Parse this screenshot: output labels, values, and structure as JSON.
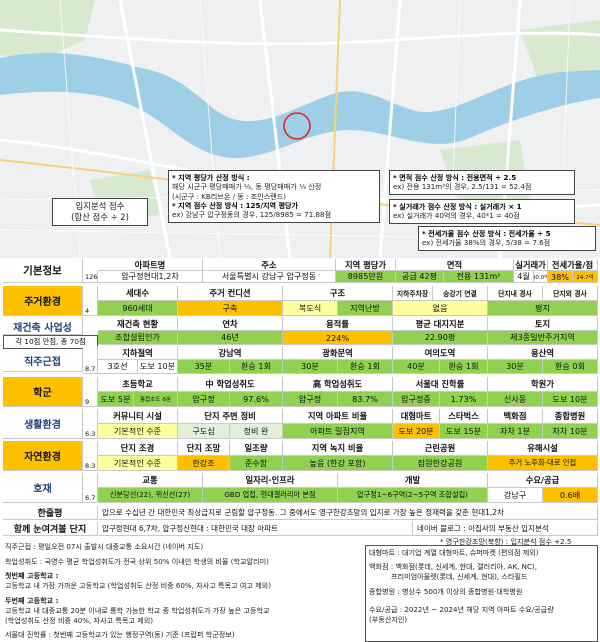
{
  "map": {
    "overlay_colors": {
      "road": "#ffffff",
      "river": "#8fc7e0",
      "park": "#cfe6c4",
      "land": "#eef0f2",
      "highlight": "#e0252b"
    },
    "callouts": {
      "site_score": {
        "title": "입지분석 점수",
        "body": "(합산 점수 ÷ 2)"
      },
      "price": {
        "l1": "* 지역 평당가 산정 방식 :",
        "l2": "해당 시군구 평당매매가 ⅔, 동 평당매매가 ⅓ 산정",
        "l3": "(시군구 : KB리브온 / 동 : 조인스랜드)",
        "l4": "* 지역 점수 산정 방식 : 125/지역 평당가",
        "l5": "ex) 강남구 압구정동의 경우, 125/8985 = 71.88점"
      },
      "area": {
        "l1": "* 면적 점수 산정 방식 : 전용면적 ÷ 2.5",
        "l2": "ex) 전용 131m²의 경우, 2.5/131 = 52.4점"
      },
      "trade": {
        "l1": "* 실거래가 점수 산정 방식 : 실거래가 × 1",
        "l2": "ex) 실거래가 40억의 경우, 40*1 = 40점"
      },
      "jeonse": {
        "l1": "* 전세가율 점수 산정 방식 : 전세가율 ÷ 5",
        "l2": "ex) 전세가율 38%의 경우, 5/38 = 7.6점"
      }
    }
  },
  "table": {
    "basic": {
      "label": "기본정보",
      "index": "126",
      "headers": {
        "apt": "아파트명",
        "addr": "주소",
        "price": "지역 평당가",
        "area": "면적",
        "trade": "실거래가",
        "jeonse": "전세가율/점"
      },
      "apt": "압구정현대1,2차",
      "addr": "서울특별시 강남구 압구정동",
      "price": "8985만원",
      "supply": "공급 42평",
      "exclusive": "전용 131m²",
      "trade": "4월",
      "trade_score": "40.0억",
      "jeonse": "38%",
      "jeonse_score": "24.7억"
    },
    "living": {
      "label": "주거환경",
      "index": "4",
      "headers": [
        "세대수",
        "주거 컨디션",
        "구조",
        "지하주차장",
        "승강기 연결",
        "단지내 경사",
        "단지외 경사"
      ],
      "values": [
        "960세대",
        "구축",
        "복도식",
        "지역난방",
        "없음",
        "",
        "평지"
      ]
    },
    "rebuild": {
      "label": "재건축 사업성",
      "note": "각 10점 만점, 총 70점",
      "headers": [
        "재건축 현황",
        "연차",
        "용적률",
        "평균 대지지분",
        "토지"
      ],
      "values": [
        "조합설립인가",
        "46년",
        "224%",
        "22.90평",
        "제3종일반주거지역"
      ]
    },
    "commute": {
      "label": "직주근접",
      "index": "8.7",
      "headers": [
        "지하철역",
        "강남역",
        "광화문역",
        "여의도역",
        "용산역"
      ],
      "values": [
        "3호선",
        "도보 10분",
        "35분",
        "환승 1회",
        "30분",
        "환승 1회",
        "40분",
        "환승 1회",
        "30분",
        "환승 0회"
      ]
    },
    "school": {
      "label": "학군",
      "index": "9",
      "headers": [
        "초등학교",
        "中 학업성취도",
        "高 학업성취도",
        "서울대 진학률",
        "학원가"
      ],
      "values": [
        "도보 5분",
        "통합초도 6분",
        "압구정",
        "97.6%",
        "압구정",
        "83.7%",
        "압구정중",
        "1.73%",
        "신사동",
        "도보 10분"
      ]
    },
    "life": {
      "label": "생활환경",
      "index": "6.3",
      "headers": [
        "커뮤니티 시설",
        "단지 주변 정비",
        "지역 아파트 비율",
        "대형마트",
        "스타벅스",
        "백화점",
        "종합병원"
      ],
      "values": [
        "기본적인 수준",
        "구도심",
        "정비 완",
        "아파트 밀집지역",
        "도보 20분",
        "도보 15분",
        "자차 1분",
        "자차 10분"
      ]
    },
    "nature": {
      "label": "자연환경",
      "index": "8.3",
      "headers": [
        "단지 조경",
        "단지 조망",
        "일조량",
        "지역 녹지 비율",
        "근린공원",
        "유해시설"
      ],
      "values": [
        "기본적인 수준",
        "한강조",
        "준수함",
        "높음 (한강 포함)",
        "잠원한강공원",
        "주거 노후화·대로 인접"
      ]
    },
    "good": {
      "label": "호재",
      "index": "6.7",
      "headers": [
        "교통",
        "일자리·인프라",
        "개발",
        "수요/공급"
      ],
      "values": [
        "신분당선(22), 위신선(27)",
        "GBD 업접, 현대갤러리아 본점",
        "압구정1~6구역(2~5구역 조합설립)",
        "강남구",
        "0.6배"
      ]
    },
    "oneliner": {
      "label": "한줄평",
      "text": "압으로 수십년 간 대한민국 최상급지로 군림할 압구정동. 그 중에서도 영구한강조망의 입지로 가장 높은 정재력을 갖춘 현대1,2차"
    },
    "together": {
      "label": "함께 눈여겨볼 단지",
      "text": "압구정현대 6,7차, 압구정신현대 : 대한민국 대장 아파트",
      "blog": "네이버 블로그 : 이집사의 부동산 입지분석"
    }
  },
  "notes": {
    "commute": "직주근접 : 평일오전 07시 출발시 대중교통 소요시간 (네이버 지도)",
    "school_perf": "학업성취도 : 국영수 평균 학업성취도가 전국 상위 50% 이내인 학생의 비율 (학교알리미)",
    "first_hs_title": "첫번째 고등학교 :",
    "first_hs_1": "고등학교 내 가장 가까운 고등학교 (학업성취도 산정 비중 60%, 자사고 특목고 여고 제외)",
    "second_hs_title": "두번째 고등학교 :",
    "second_hs_1": "고등학교 내 대중교통 20분 이내로 통학 가능한 학교 중 학업성취도가 가장 높은 고등학교",
    "second_hs_2": "(학업성취도 산정 비중 40%, 자사고 특목고 제외)",
    "seoul_univ": "서울대 진학률 : 첫번째 고등학교가 있는 행정구역(동) 기준 (프랍퍼 학군정보)",
    "han_view": "* 영구한강조망(북향) : 입지분석 점수 +2.5",
    "mart": "대형마트 : 대기업 계열 대형마트, 슈퍼마켓 (편의점 제외)",
    "dept": "백화점 : 백화점(롯데, 신세계, 현대, 갤러리아, AK, NC),",
    "dept2": "프리미엄아울렛(롯데, 신세계, 현대), 스타필드",
    "hospital": "종합병원 : 병상수 500개 이상의 종합병원·대학병원",
    "supply": "수요/공급 : 2022년 ~ 2024년 해당 지역 아파트 수요/공급량",
    "supply2": "(부동산지인)"
  }
}
